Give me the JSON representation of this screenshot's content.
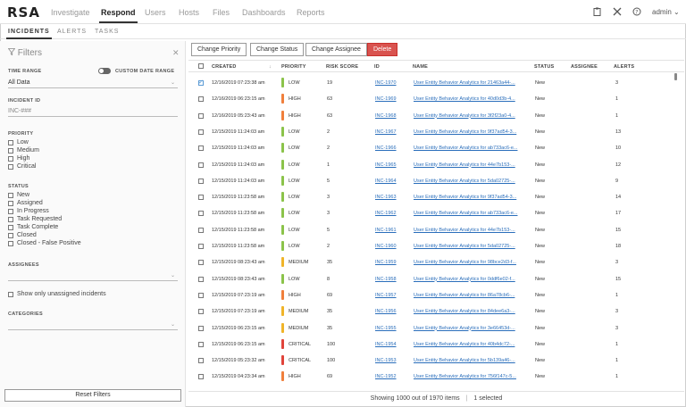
{
  "logo": "RSA",
  "nav": [
    "Investigate",
    "Respond",
    "Users",
    "Hosts",
    "Files",
    "Dashboards",
    "Reports"
  ],
  "user": "admin",
  "subnav": [
    "INCIDENTS",
    "ALERTS",
    "TASKS"
  ],
  "filters": {
    "title": "Filters",
    "time_range_label": "TIME RANGE",
    "custom_date_range_label": "CUSTOM DATE RANGE",
    "time_range_value": "All Data",
    "incident_id_label": "INCIDENT ID",
    "incident_id_placeholder": "INC-###",
    "priority_label": "PRIORITY",
    "priorities": [
      "Low",
      "Medium",
      "High",
      "Critical"
    ],
    "status_label": "STATUS",
    "statuses": [
      "New",
      "Assigned",
      "In Progress",
      "Task Requested",
      "Task Complete",
      "Closed",
      "Closed - False Positive"
    ],
    "assignee_label": "ASSIGNEES",
    "unassigned_label": "Show only unassigned incidents",
    "categories_label": "CATEGORIES",
    "reset_label": "Reset Filters"
  },
  "toolbar": {
    "change_priority": "Change Priority",
    "change_status": "Change Status",
    "change_assignee": "Change Assignee",
    "delete": "Delete"
  },
  "columns": {
    "created": "CREATED",
    "priority": "PRIORITY",
    "risk_score": "RISK SCORE",
    "id": "ID",
    "name": "NAME",
    "status": "STATUS",
    "assignee": "ASSIGNEE",
    "alerts": "ALERTS"
  },
  "colors": {
    "low": "#8bc34a",
    "medium": "#f0b429",
    "high": "#f07f3c",
    "critical": "#e0443a",
    "link": "#2a6ebb"
  },
  "rows": [
    {
      "checked": true,
      "created": "12/16/2019 07:23:38 am",
      "priority": "LOW",
      "risk": "19",
      "id": "INC-1970",
      "name": "User Entity Behavior Analytics for 21463a44-...",
      "status": "New",
      "alerts": "3"
    },
    {
      "checked": false,
      "created": "12/16/2019 06:23:15 am",
      "priority": "HIGH",
      "risk": "63",
      "id": "INC-1969",
      "name": "User Entity Behavior Analytics for 40d0d3b-4...",
      "status": "New",
      "alerts": "1"
    },
    {
      "checked": false,
      "created": "12/16/2019 05:23:43 am",
      "priority": "HIGH",
      "risk": "63",
      "id": "INC-1968",
      "name": "User Entity Behavior Analytics for 3f2f23a0-4...",
      "status": "New",
      "alerts": "1"
    },
    {
      "checked": false,
      "created": "12/15/2019 11:24:03 am",
      "priority": "LOW",
      "risk": "2",
      "id": "INC-1967",
      "name": "User Entity Behavior Analytics for 9f37ad54-3...",
      "status": "New",
      "alerts": "13"
    },
    {
      "checked": false,
      "created": "12/15/2019 11:24:03 am",
      "priority": "LOW",
      "risk": "2",
      "id": "INC-1966",
      "name": "User Entity Behavior Analytics for ab733ac6-e...",
      "status": "New",
      "alerts": "10"
    },
    {
      "checked": false,
      "created": "12/15/2019 11:24:03 am",
      "priority": "LOW",
      "risk": "1",
      "id": "INC-1965",
      "name": "User Entity Behavior Analytics for 44e7b153-...",
      "status": "New",
      "alerts": "12"
    },
    {
      "checked": false,
      "created": "12/15/2019 11:24:03 am",
      "priority": "LOW",
      "risk": "5",
      "id": "INC-1964",
      "name": "User Entity Behavior Analytics for 5da02725-...",
      "status": "New",
      "alerts": "9"
    },
    {
      "checked": false,
      "created": "12/15/2019 11:23:58 am",
      "priority": "LOW",
      "risk": "3",
      "id": "INC-1963",
      "name": "User Entity Behavior Analytics for 9f37ad54-3...",
      "status": "New",
      "alerts": "14"
    },
    {
      "checked": false,
      "created": "12/15/2019 11:23:58 am",
      "priority": "LOW",
      "risk": "3",
      "id": "INC-1962",
      "name": "User Entity Behavior Analytics for ab733ac6-e...",
      "status": "New",
      "alerts": "17"
    },
    {
      "checked": false,
      "created": "12/15/2019 11:23:58 am",
      "priority": "LOW",
      "risk": "5",
      "id": "INC-1961",
      "name": "User Entity Behavior Analytics for 44e7b153-...",
      "status": "New",
      "alerts": "15"
    },
    {
      "checked": false,
      "created": "12/15/2019 11:23:58 am",
      "priority": "LOW",
      "risk": "2",
      "id": "INC-1960",
      "name": "User Entity Behavior Analytics for 5da02725-...",
      "status": "New",
      "alerts": "18"
    },
    {
      "checked": false,
      "created": "12/15/2019 08:23:43 am",
      "priority": "MEDIUM",
      "risk": "35",
      "id": "INC-1959",
      "name": "User Entity Behavior Analytics for 98bce2d3-f...",
      "status": "New",
      "alerts": "3"
    },
    {
      "checked": false,
      "created": "12/15/2019 08:23:43 am",
      "priority": "LOW",
      "risk": "8",
      "id": "INC-1958",
      "name": "User Entity Behavior Analytics for 0ddf6e02-f...",
      "status": "New",
      "alerts": "15"
    },
    {
      "checked": false,
      "created": "12/15/2019 07:23:19 am",
      "priority": "HIGH",
      "risk": "69",
      "id": "INC-1957",
      "name": "User Entity Behavior Analytics for 86a78cb6-...",
      "status": "New",
      "alerts": "1"
    },
    {
      "checked": false,
      "created": "12/15/2019 07:23:19 am",
      "priority": "MEDIUM",
      "risk": "35",
      "id": "INC-1956",
      "name": "User Entity Behavior Analytics for 84dee6a3-...",
      "status": "New",
      "alerts": "3"
    },
    {
      "checked": false,
      "created": "12/15/2019 06:23:15 am",
      "priority": "MEDIUM",
      "risk": "35",
      "id": "INC-1955",
      "name": "User Entity Behavior Analytics for 3e66453d-...",
      "status": "New",
      "alerts": "3"
    },
    {
      "checked": false,
      "created": "12/15/2019 06:23:15 am",
      "priority": "CRITICAL",
      "risk": "100",
      "id": "INC-1954",
      "name": "User Entity Behavior Analytics for 40b4dc72-...",
      "status": "New",
      "alerts": "1"
    },
    {
      "checked": false,
      "created": "12/15/2019 05:23:32 am",
      "priority": "CRITICAL",
      "risk": "100",
      "id": "INC-1953",
      "name": "User Entity Behavior Analytics for 5b139a46-...",
      "status": "New",
      "alerts": "1"
    },
    {
      "checked": false,
      "created": "12/15/2019 04:23:34 am",
      "priority": "HIGH",
      "risk": "69",
      "id": "INC-1952",
      "name": "User Entity Behavior Analytics for 756f147c-5...",
      "status": "New",
      "alerts": "1"
    }
  ],
  "footer": {
    "showing": "Showing 1000 out of 1970 items",
    "separator": "|",
    "selected": "1 selected"
  }
}
